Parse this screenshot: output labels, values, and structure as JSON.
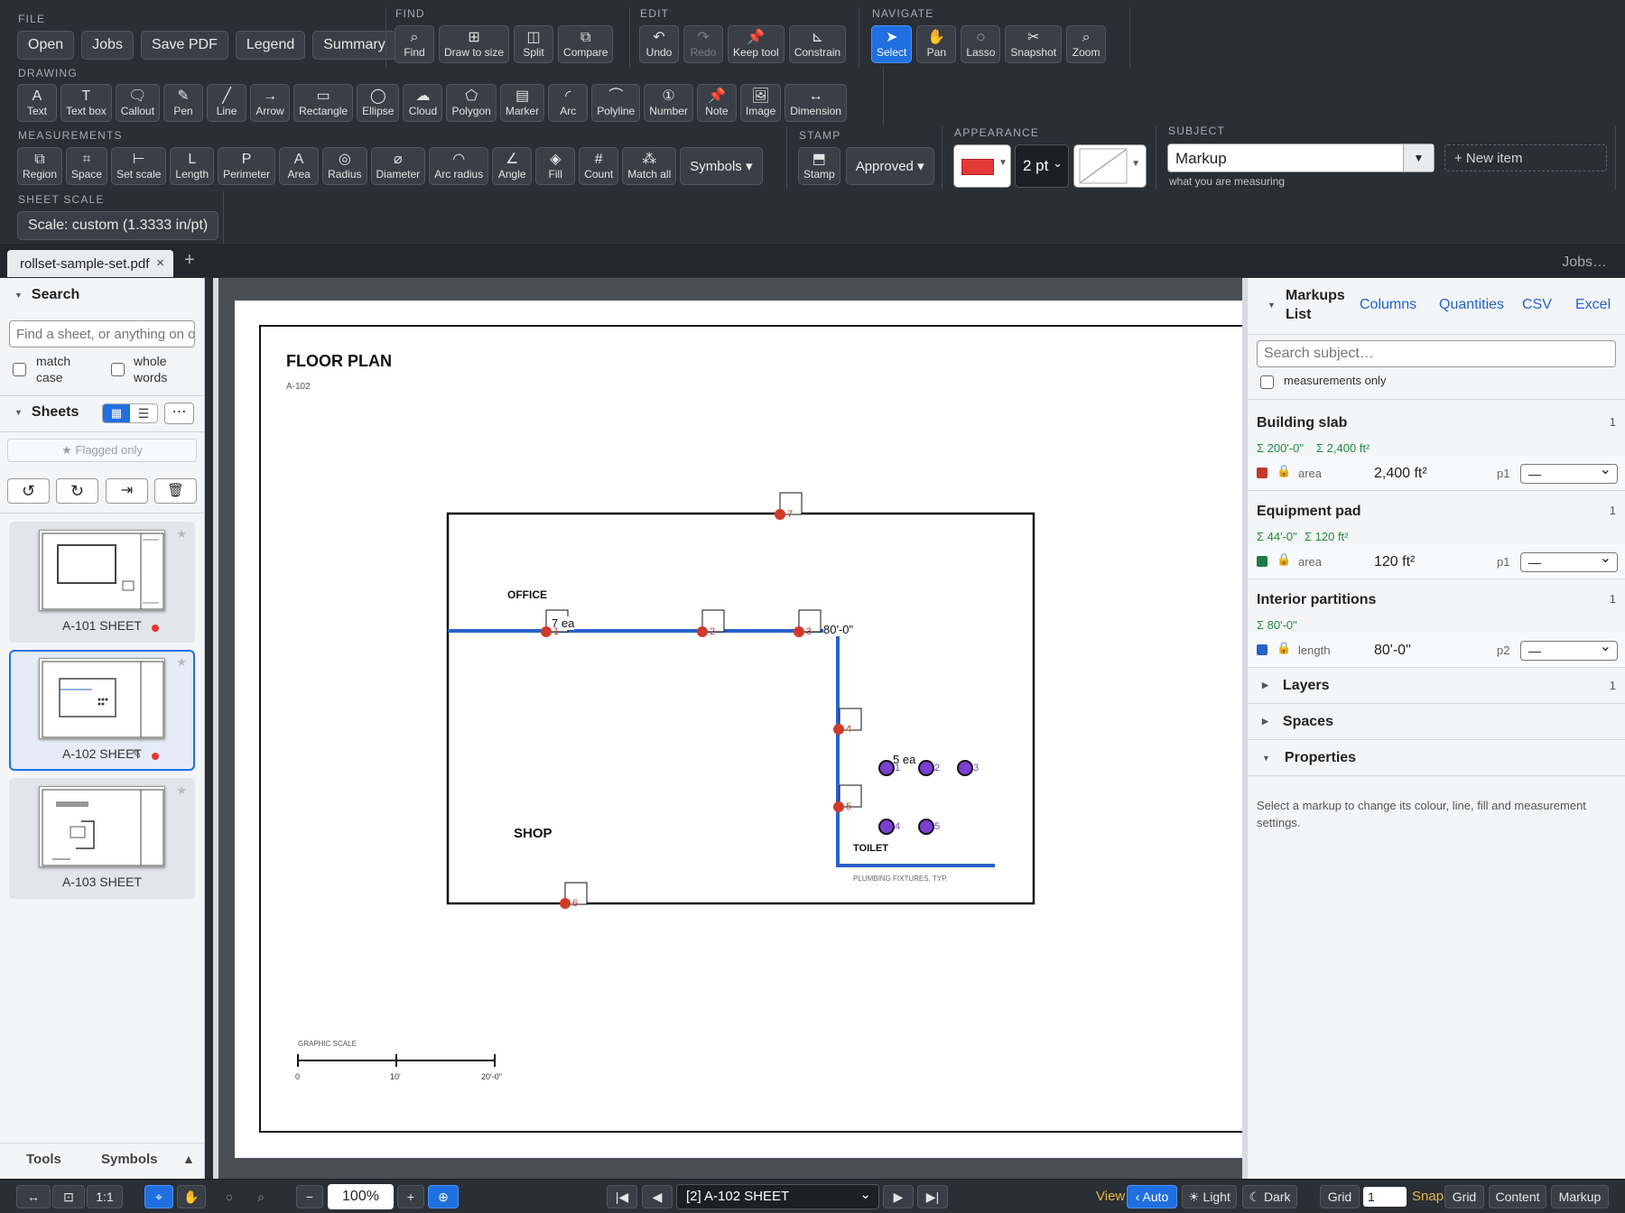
{
  "toolbar": {
    "file": {
      "title": "FILE",
      "buttons": [
        "Open",
        "Jobs",
        "Save PDF",
        "Legend",
        "Summary"
      ]
    },
    "find": {
      "title": "FIND",
      "buttons": [
        {
          "icon": "⌕",
          "label": "Find",
          "name": "find"
        },
        {
          "icon": "⊞",
          "label": "Draw to size",
          "name": "draw-to-size"
        },
        {
          "icon": "◫",
          "label": "Split",
          "name": "split"
        },
        {
          "icon": "⧉",
          "label": "Compare",
          "name": "compare"
        }
      ]
    },
    "edit": {
      "title": "EDIT",
      "buttons": [
        {
          "icon": "↶",
          "label": "Undo",
          "name": "undo"
        },
        {
          "icon": "↷",
          "label": "Redo",
          "name": "redo"
        },
        {
          "icon": "📌",
          "label": "Keep tool",
          "name": "keep-tool"
        },
        {
          "icon": "⊾",
          "label": "Constrain",
          "name": "constrain"
        }
      ]
    },
    "navigate": {
      "title": "NAVIGATE",
      "buttons": [
        {
          "icon": "➤",
          "label": "Select",
          "name": "select"
        },
        {
          "icon": "✋",
          "label": "Pan",
          "name": "pan"
        },
        {
          "icon": "◌",
          "label": "Lasso",
          "name": "lasso"
        },
        {
          "icon": "✂",
          "label": "Snapshot",
          "name": "snapshot"
        },
        {
          "icon": "⌕",
          "label": "Zoom",
          "name": "zoom"
        }
      ]
    },
    "drawing": {
      "title": "DRAWING",
      "buttons": [
        {
          "icon": "A",
          "label": "Text"
        },
        {
          "icon": "T",
          "label": "Text box"
        },
        {
          "icon": "🗨",
          "label": "Callout"
        },
        {
          "icon": "✎",
          "label": "Pen"
        },
        {
          "icon": "╱",
          "label": "Line"
        },
        {
          "icon": "→",
          "label": "Arrow"
        },
        {
          "icon": "▭",
          "label": "Rectangle"
        },
        {
          "icon": "◯",
          "label": "Ellipse"
        },
        {
          "icon": "☁",
          "label": "Cloud"
        },
        {
          "icon": "⬠",
          "label": "Polygon"
        },
        {
          "icon": "▤",
          "label": "Marker"
        },
        {
          "icon": "◜",
          "label": "Arc"
        },
        {
          "icon": "⌒",
          "label": "Polyline"
        },
        {
          "icon": "①",
          "label": "Number"
        },
        {
          "icon": "📌",
          "label": "Note"
        },
        {
          "icon": "🖼",
          "label": "Image"
        },
        {
          "icon": "↔",
          "label": "Dimension"
        }
      ]
    },
    "measurements": {
      "title": "MEASUREMENTS",
      "buttons": [
        {
          "icon": "⧉",
          "label": "Region"
        },
        {
          "icon": "⌗",
          "label": "Space"
        },
        {
          "icon": "⊢",
          "label": "Set scale"
        },
        {
          "icon": "L",
          "label": "Length"
        },
        {
          "icon": "P",
          "label": "Perimeter"
        },
        {
          "icon": "A",
          "label": "Area"
        },
        {
          "icon": "◎",
          "label": "Radius"
        },
        {
          "icon": "⌀",
          "label": "Diameter"
        },
        {
          "icon": "◠",
          "label": "Arc radius"
        },
        {
          "icon": "∠",
          "label": "Angle"
        },
        {
          "icon": "◈",
          "label": "Fill"
        },
        {
          "icon": "#",
          "label": "Count"
        },
        {
          "icon": "⁂",
          "label": "Match all"
        }
      ],
      "symbols": "Symbols ▾"
    },
    "stamp": {
      "title": "STAMP",
      "button": {
        "icon": "⬒",
        "label": "Stamp"
      },
      "select": "Approved ▾"
    },
    "appearance": {
      "title": "APPEARANCE",
      "color": "#e53935",
      "width": "2 pt"
    },
    "subject": {
      "title": "SUBJECT",
      "value": "Markup",
      "hint": "what you are measuring",
      "new_item": "+ New item"
    },
    "sheet_scale": {
      "title": "SHEET SCALE",
      "value": "Scale: custom (1.3333 in/pt)"
    }
  },
  "tabs": {
    "doc": "rollset-sample-set.pdf",
    "close": "×",
    "add": "+",
    "jobs": "Jobs…"
  },
  "left": {
    "search_title": "Search",
    "search_placeholder": "Find a sheet, or anything on o",
    "match_case": "match case",
    "whole_words": "whole words",
    "sheets_title": "Sheets",
    "more": "⋯",
    "flagged": "★ Flagged only",
    "sheets": [
      {
        "label": "A-101 SHEET"
      },
      {
        "label": "A-102 SHEET",
        "edit": "✎"
      },
      {
        "label": "A-103 SHEET"
      }
    ],
    "footer_tools": "Tools",
    "footer_symbols": "Symbols",
    "footer_arrow": "▲"
  },
  "drawing": {
    "title": "FLOOR PLAN",
    "sheet_no": "A-102",
    "office": "OFFICE",
    "shop": "SHOP",
    "toilet": "TOILET",
    "plumbing": "PLUMBING FIXTURES, TYP.",
    "count_label": "7 ea",
    "length_label": "80'-0\"",
    "fixture_label": "5 ea",
    "scale_title": "GRAPHIC SCALE",
    "scale_ticks": [
      "0",
      "10'",
      "20'-0\""
    ],
    "points": [
      "1",
      "2",
      "3",
      "4",
      "5",
      "6",
      "7"
    ],
    "fixtures": [
      "1",
      "2",
      "3",
      "4",
      "5"
    ]
  },
  "markups": {
    "title": "Markups List",
    "links": [
      "Columns",
      "Quantities",
      "CSV",
      "Excel"
    ],
    "search_placeholder": "Search subject…",
    "measurements_only": "measurements only",
    "groups": [
      {
        "name": "Building slab",
        "count": "1",
        "sums": [
          "Σ 200'-0\"",
          "Σ 2,400 ft²"
        ],
        "color": "#c0392b",
        "kind": "area",
        "value": "2,400 ft²",
        "page": "p1",
        "sel": "—"
      },
      {
        "name": "Equipment pad",
        "count": "1",
        "sums": [
          "Σ 44'-0\"",
          "Σ 120 ft²"
        ],
        "color": "#1e7a46",
        "kind": "area",
        "value": "120 ft²",
        "page": "p1",
        "sel": "—"
      },
      {
        "name": "Interior partitions",
        "count": "1",
        "sums": [
          "Σ 80'-0\""
        ],
        "color": "#2962c9",
        "kind": "length",
        "value": "80'-0\"",
        "page": "p2",
        "sel": "—"
      }
    ],
    "layers": "Layers",
    "layers_count": "1",
    "spaces": "Spaces",
    "properties": "Properties",
    "properties_text": "Select a markup to change its colour, line, fill and measurement settings."
  },
  "status": {
    "zoom": "100%",
    "page": "[2] A-102 SHEET",
    "view": "View",
    "auto": "‹ Auto",
    "light": "☀ Light",
    "dark": "☾ Dark",
    "grid": "Grid",
    "grid_value": "1",
    "snap": "Snap",
    "snap_grid": "Grid",
    "content": "Content",
    "markup": "Markup",
    "one_to_one": "1:1"
  }
}
